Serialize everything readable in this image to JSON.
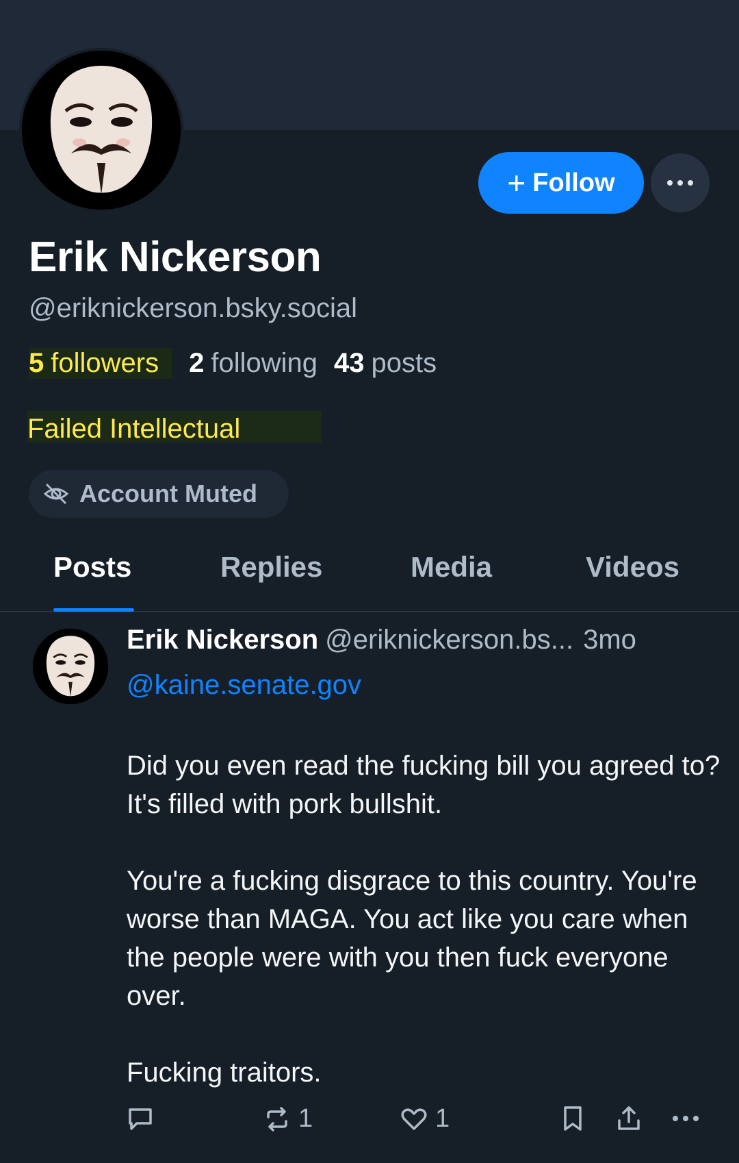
{
  "profile": {
    "display_name": "Erik Nickerson",
    "handle": "@eriknickerson.bsky.social",
    "stats": {
      "followers_count": "5",
      "followers_label": "followers",
      "following_count": "2",
      "following_label": "following",
      "posts_count": "43",
      "posts_label": "posts"
    },
    "bio": "Failed Intellectual",
    "muted_label": "Account Muted",
    "avatar_icon": "guy-fawkes-mask-avatar"
  },
  "actions": {
    "follow_plus": "+",
    "follow_label": "Follow",
    "more_icon": "ellipsis-icon"
  },
  "tabs": [
    {
      "label": "Posts",
      "active": true
    },
    {
      "label": "Replies",
      "active": false
    },
    {
      "label": "Media",
      "active": false
    },
    {
      "label": "Videos",
      "active": false
    }
  ],
  "post": {
    "author_name": "Erik Nickerson",
    "author_handle": "@eriknickerson.bs...",
    "time": "3mo",
    "mention": "@kaine.senate.gov",
    "paragraphs": [
      "Did you even read the fucking bill you agreed to? It's filled with pork bullshit.",
      "You're a fucking disgrace to this country. You're worse than MAGA. You act like you care when the people were with you then fuck everyone over.",
      "Fucking traitors."
    ],
    "reply_icon": "reply-icon",
    "repost_icon": "repost-icon",
    "repost_count": "1",
    "like_icon": "heart-icon",
    "like_count": "1",
    "bookmark_icon": "bookmark-icon",
    "share_icon": "share-icon",
    "more_icon": "ellipsis-icon"
  },
  "colors": {
    "background": "#161e27",
    "banner": "#1f2937",
    "accent": "#1083fe",
    "muted_text": "#aebbc9",
    "highlight_text": "#ffe94d"
  }
}
